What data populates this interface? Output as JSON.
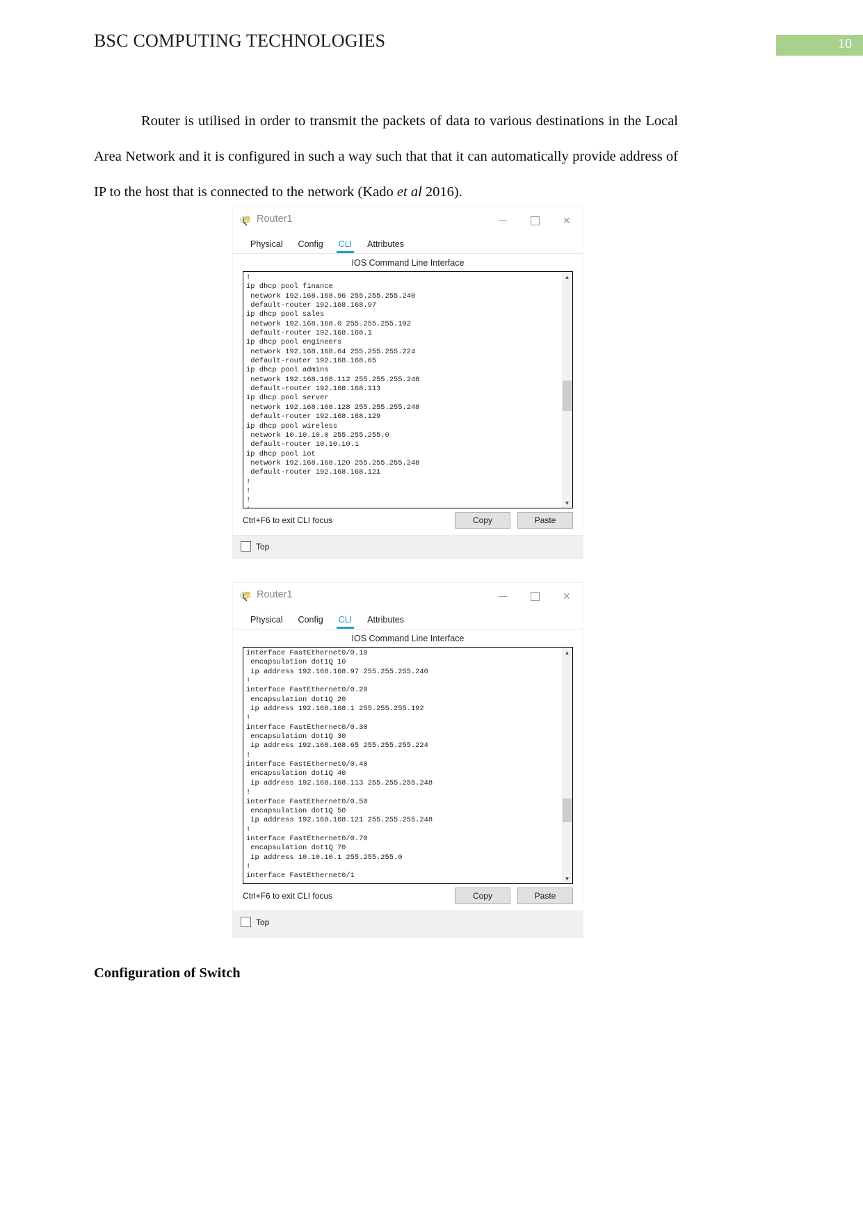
{
  "header": {
    "doc_title": "BSC COMPUTING TECHNOLOGIES",
    "page_number": "10",
    "badge_color": "#a9d18e"
  },
  "paragraph": {
    "part1": "Router is utilised in order to transmit the packets of data to various destinations in the Local Area Network and it is configured in such a way such that that it can automatically provide address of IP to the host that is connected to the network (Kado ",
    "italic": "et al",
    "part2": " 2016)."
  },
  "windows": [
    {
      "title": "Router1",
      "app_icon": "packet-tracer-router-icon",
      "minimize_label": "—",
      "maximize_label": "",
      "close_label": "✕",
      "tabs": [
        {
          "label": "Physical",
          "active": false
        },
        {
          "label": "Config",
          "active": false
        },
        {
          "label": "CLI",
          "active": true
        },
        {
          "label": "Attributes",
          "active": false
        }
      ],
      "caption": "IOS Command Line Interface",
      "cli_text": "!\nip dhcp pool finance\n network 192.168.168.96 255.255.255.240\n default-router 192.168.168.97\nip dhcp pool sales\n network 192.168.168.0 255.255.255.192\n default-router 192.168.168.1\nip dhcp pool engineers\n network 192.168.168.64 255.255.255.224\n default-router 192.168.168.65\nip dhcp pool admins\n network 192.168.168.112 255.255.255.248\n default-router 192.168.168.113\nip dhcp pool server\n network 192.168.168.128 255.255.255.248\n default-router 192.168.168.129\nip dhcp pool wireless\n network 10.10.10.0 255.255.255.0\n default-router 10.10.10.1\nip dhcp pool iot\n network 192.168.168.120 255.255.255.248\n default-router 192.168.168.121\n!\n!\n!\n!",
      "scroll": {
        "up_arrow": "▲",
        "down_arrow": "▼",
        "thumb_top_pct": 46,
        "thumb_height_pct": 13
      },
      "hint": "Ctrl+F6 to exit CLI focus",
      "copy_label": "Copy",
      "paste_label": "Paste",
      "checkbox_label": "Top",
      "checkbox_checked": false
    },
    {
      "title": "Router1",
      "app_icon": "packet-tracer-router-icon",
      "minimize_label": "—",
      "maximize_label": "",
      "close_label": "✕",
      "tabs": [
        {
          "label": "Physical",
          "active": false
        },
        {
          "label": "Config",
          "active": false
        },
        {
          "label": "CLI",
          "active": true
        },
        {
          "label": "Attributes",
          "active": false
        }
      ],
      "caption": "IOS Command Line Interface",
      "cli_text": "interface FastEthernet0/0.10\n encapsulation dot1Q 10\n ip address 192.168.168.97 255.255.255.240\n!\ninterface FastEthernet0/0.20\n encapsulation dot1Q 20\n ip address 192.168.168.1 255.255.255.192\n!\ninterface FastEthernet0/0.30\n encapsulation dot1Q 30\n ip address 192.168.168.65 255.255.255.224\n!\ninterface FastEthernet0/0.40\n encapsulation dot1Q 40\n ip address 192.168.168.113 255.255.255.248\n!\ninterface FastEthernet0/0.50\n encapsulation dot1Q 50\n ip address 192.168.168.121 255.255.255.248\n!\ninterface FastEthernet0/0.70\n encapsulation dot1Q 70\n ip address 10.10.10.1 255.255.255.0\n!\ninterface FastEthernet0/1",
      "scroll": {
        "up_arrow": "▲",
        "down_arrow": "▼",
        "thumb_top_pct": 64,
        "thumb_height_pct": 10
      },
      "hint": "Ctrl+F6 to exit CLI focus",
      "copy_label": "Copy",
      "paste_label": "Paste",
      "checkbox_label": "Top",
      "checkbox_checked": false
    }
  ],
  "section_heading": "Configuration of Switch"
}
